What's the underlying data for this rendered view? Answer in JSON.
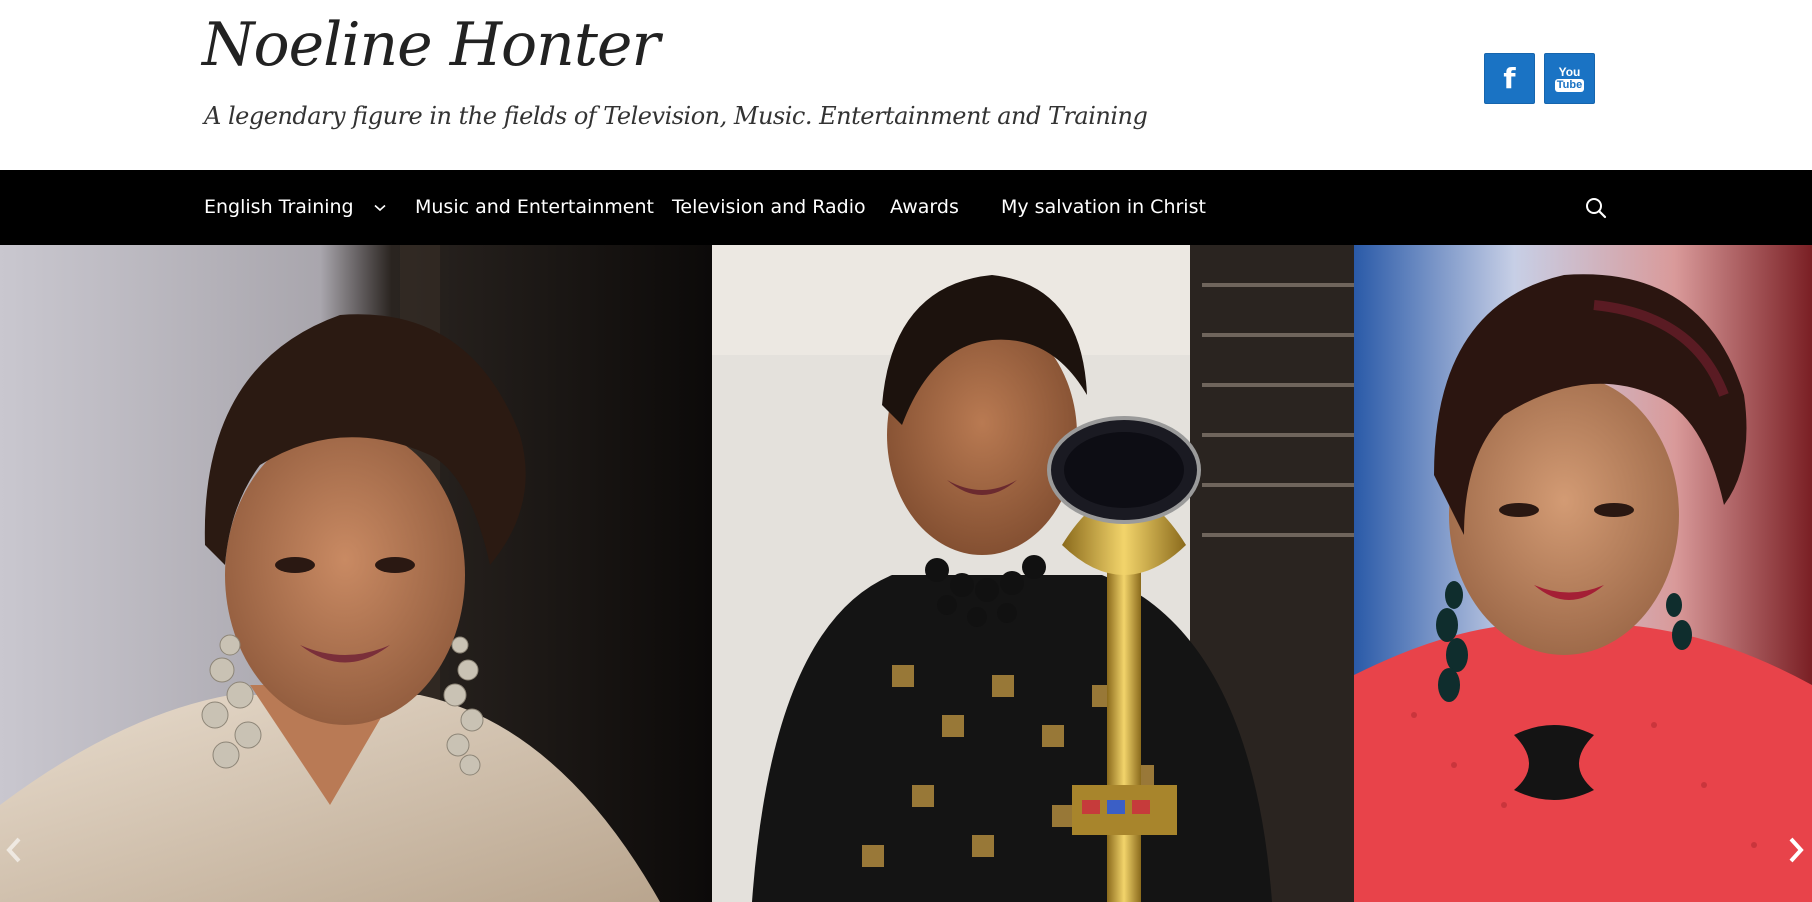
{
  "header": {
    "title": "Noeline Honter",
    "tagline": "A legendary figure in the fields of Television, Music. Entertainment and Training"
  },
  "social": {
    "items": [
      {
        "icon": "facebook-icon",
        "glyph": "f"
      },
      {
        "icon": "youtube-icon",
        "line1": "You",
        "line2": "Tube"
      }
    ]
  },
  "nav": {
    "items": [
      {
        "label": "English Training",
        "has_dropdown": true
      },
      {
        "label": "Music and Entertainment"
      },
      {
        "label": "Television and Radio"
      },
      {
        "label": "Awards"
      },
      {
        "label": "My salvation in Christ"
      }
    ],
    "search_icon": "search-icon"
  },
  "slider": {
    "slides": [
      {
        "image": "portrait-photo-1"
      },
      {
        "image": "award-photo"
      },
      {
        "image": "portrait-photo-2"
      }
    ],
    "prev_icon": "chevron-left-icon",
    "next_icon": "chevron-right-icon"
  },
  "colors": {
    "nav_background": "#000000",
    "social_blue": "#1a73c4",
    "text": "#222222"
  }
}
